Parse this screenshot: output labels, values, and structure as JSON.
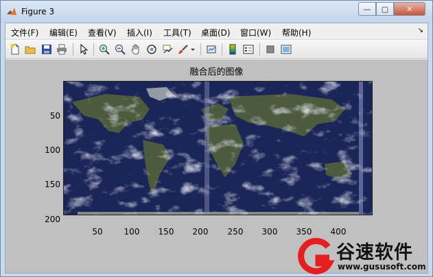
{
  "window": {
    "title": "Figure 3",
    "min_glyph": "—",
    "max_glyph": "▢",
    "close_glyph": "✕"
  },
  "menu": {
    "items": [
      "文件(F)",
      "编辑(E)",
      "查看(V)",
      "插入(I)",
      "工具(T)",
      "桌面(D)",
      "窗口(W)",
      "帮助(H)"
    ],
    "overflow_glyph": "↘"
  },
  "toolbar": {
    "icons": [
      "new-figure-icon",
      "open-file-icon",
      "save-icon",
      "print-icon",
      "select-arrow-icon",
      "zoom-in-icon",
      "zoom-out-icon",
      "pan-hand-icon",
      "rotate-3d-icon",
      "data-cursor-icon",
      "brush-icon",
      "link-plot-icon",
      "colorbar-icon",
      "legend-icon",
      "hide-plot-tools-icon",
      "show-plot-tools-icon"
    ]
  },
  "figure": {
    "title": "融合后的图像",
    "y_ticks": [
      "50",
      "100",
      "150",
      "200"
    ],
    "x_ticks": [
      "50",
      "100",
      "150",
      "200",
      "250",
      "300",
      "350",
      "400"
    ]
  },
  "watermark": {
    "title": "谷速软件",
    "url": "www.gususoft.com",
    "color": "#e51f1f"
  },
  "colors": {
    "ocean": "#1b2658",
    "land": "#4f5d3c",
    "cloud": "#b9bfd0"
  }
}
